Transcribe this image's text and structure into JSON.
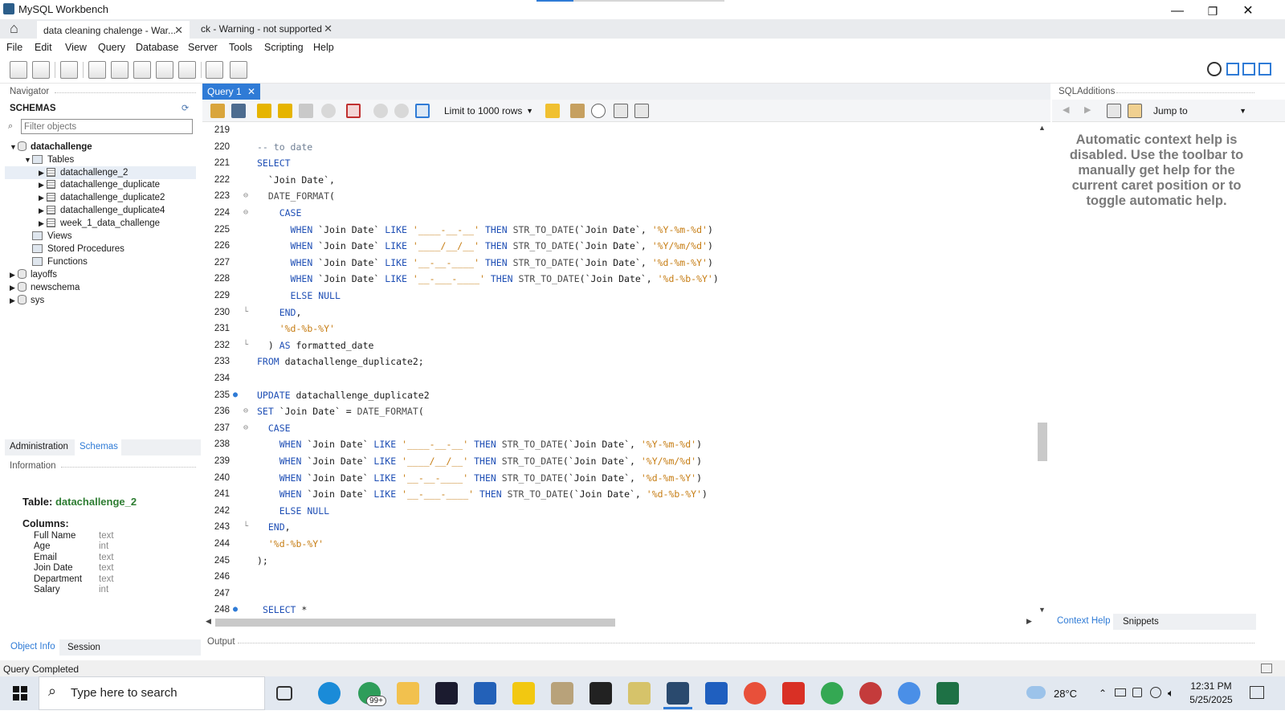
{
  "window": {
    "title": "MySQL Workbench",
    "minimize": "—",
    "restore": "❐",
    "close": "✕"
  },
  "file_tabs": [
    {
      "label": "data cleaning chalenge - War...",
      "close": "✕"
    },
    {
      "label": "ck - Warning - not supported",
      "close": "✕"
    }
  ],
  "menu": [
    "File",
    "Edit",
    "View",
    "Query",
    "Database",
    "Server",
    "Tools",
    "Scripting",
    "Help"
  ],
  "navigator": {
    "header": "Navigator",
    "schemas_title": "SCHEMAS",
    "filter_placeholder": "Filter objects",
    "tree": {
      "db1": "datachallenge",
      "tables": "Tables",
      "table_items": [
        "datachallenge_2",
        "datachallenge_duplicate",
        "datachallenge_duplicate2",
        "datachallenge_duplicate4",
        "week_1_data_challenge"
      ],
      "views": "Views",
      "procedures": "Stored Procedures",
      "functions": "Functions",
      "other_dbs": [
        "layoffs",
        "newschema",
        "sys"
      ]
    },
    "tabs": {
      "administration": "Administration",
      "schemas": "Schemas"
    }
  },
  "information": {
    "header": "Information",
    "table_label": "Table:",
    "table_name": "datachallenge_2",
    "columns_label": "Columns:",
    "columns": [
      {
        "name": "Full Name",
        "type": "text"
      },
      {
        "name": "Age",
        "type": "int"
      },
      {
        "name": "Email",
        "type": "text"
      },
      {
        "name": "Join Date",
        "type": "text"
      },
      {
        "name": "Department",
        "type": "text"
      },
      {
        "name": "Salary",
        "type": "int"
      }
    ],
    "tabs": {
      "object_info": "Object Info",
      "session": "Session"
    }
  },
  "editor": {
    "tab_label": "Query 1",
    "tab_close": "✕",
    "limit_label": "Limit to 1000 rows"
  },
  "code_lines": [
    {
      "n": "219",
      "text": ""
    },
    {
      "n": "220",
      "text": "-- to date"
    },
    {
      "n": "221",
      "text": "SELECT"
    },
    {
      "n": "222",
      "text": "  `Join Date`,"
    },
    {
      "n": "223",
      "text": "  DATE_FORMAT("
    },
    {
      "n": "224",
      "text": "    CASE"
    },
    {
      "n": "225",
      "text": "      WHEN `Join Date` LIKE '____-__-__' THEN STR_TO_DATE(`Join Date`, '%Y-%m-%d')"
    },
    {
      "n": "226",
      "text": "      WHEN `Join Date` LIKE '____/__/__' THEN STR_TO_DATE(`Join Date`, '%Y/%m/%d')"
    },
    {
      "n": "227",
      "text": "      WHEN `Join Date` LIKE '__-__-____' THEN STR_TO_DATE(`Join Date`, '%d-%m-%Y')"
    },
    {
      "n": "228",
      "text": "      WHEN `Join Date` LIKE '__-___-____' THEN STR_TO_DATE(`Join Date`, '%d-%b-%Y')"
    },
    {
      "n": "229",
      "text": "      ELSE NULL"
    },
    {
      "n": "230",
      "text": "    END,"
    },
    {
      "n": "231",
      "text": "    '%d-%b-%Y'"
    },
    {
      "n": "232",
      "text": "  ) AS formatted_date"
    },
    {
      "n": "233",
      "text": "FROM datachallenge_duplicate2;"
    },
    {
      "n": "234",
      "text": ""
    },
    {
      "n": "235",
      "text": "UPDATE datachallenge_duplicate2"
    },
    {
      "n": "236",
      "text": "SET `Join Date` = DATE_FORMAT("
    },
    {
      "n": "237",
      "text": "  CASE"
    },
    {
      "n": "238",
      "text": "    WHEN `Join Date` LIKE '____-__-__' THEN STR_TO_DATE(`Join Date`, '%Y-%m-%d')"
    },
    {
      "n": "239",
      "text": "    WHEN `Join Date` LIKE '____/__/__' THEN STR_TO_DATE(`Join Date`, '%Y/%m/%d')"
    },
    {
      "n": "240",
      "text": "    WHEN `Join Date` LIKE '__-__-____' THEN STR_TO_DATE(`Join Date`, '%d-%m-%Y')"
    },
    {
      "n": "241",
      "text": "    WHEN `Join Date` LIKE '__-___-____' THEN STR_TO_DATE(`Join Date`, '%d-%b-%Y')"
    },
    {
      "n": "242",
      "text": "    ELSE NULL"
    },
    {
      "n": "243",
      "text": "  END,"
    },
    {
      "n": "244",
      "text": "  '%d-%b-%Y'"
    },
    {
      "n": "245",
      "text": ");"
    },
    {
      "n": "246",
      "text": ""
    },
    {
      "n": "247",
      "text": ""
    },
    {
      "n": "248",
      "text": " SELECT *"
    }
  ],
  "output": {
    "header": "Output"
  },
  "sql_additions": {
    "header": "SQLAdditions",
    "jump_to": "Jump to",
    "help_text": "Automatic context help is disabled. Use the toolbar to manually get help for the current caret position or to toggle automatic help.",
    "tabs": {
      "context_help": "Context Help",
      "snippets": "Snippets"
    }
  },
  "status": {
    "text": "Query Completed"
  },
  "taskbar": {
    "search_placeholder": "Type here to search",
    "notification_badge": "99+",
    "weather": "28°C",
    "time": "12:31 PM",
    "date": "5/25/2025"
  },
  "colors": {
    "accent": "#2f7bd6",
    "keyword": "#1f4fb5",
    "string": "#c67c12",
    "comment": "#6f7f94",
    "schema_green": "#2e7d32"
  }
}
